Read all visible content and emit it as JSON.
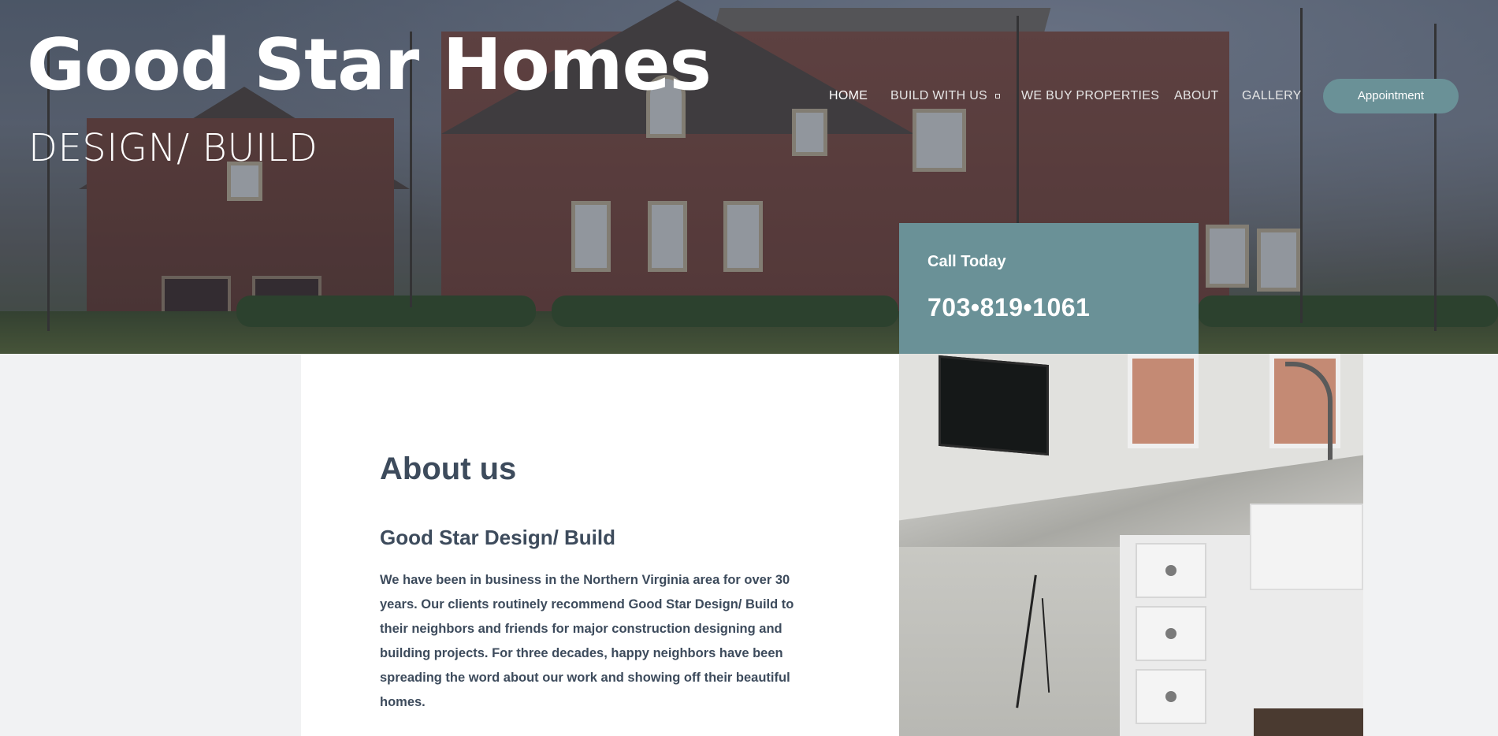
{
  "brand": {
    "title": "Good Star Homes",
    "subtitle": "DESIGN/ BUILD"
  },
  "nav": {
    "items": [
      {
        "label": "HOME",
        "active": true
      },
      {
        "label": "BUILD WITH US",
        "has_dropdown": true
      },
      {
        "label": "WE BUY PROPERTIES"
      },
      {
        "label": "ABOUT"
      },
      {
        "label": "GALLERY"
      }
    ],
    "cta_label": "Appointment"
  },
  "call": {
    "label": "Call Today",
    "phone": "703•819•1061"
  },
  "about": {
    "heading": "About us",
    "subheading": "Good Star Design/ Build",
    "body": "We have been in business in the Northern Virginia area for over 30 years.  Our clients routinely recommend Good Star Design/ Build to their neighbors and friends for major construction designing and building projects.  For three decades, happy neighbors have been spreading the word about our work and showing off their beautiful homes."
  },
  "colors": {
    "accent": "#6a9197",
    "heading_text": "#3d4b5c",
    "page_bg": "#f1f2f3"
  },
  "icons": {
    "dropdown": "chevron-down-icon"
  }
}
